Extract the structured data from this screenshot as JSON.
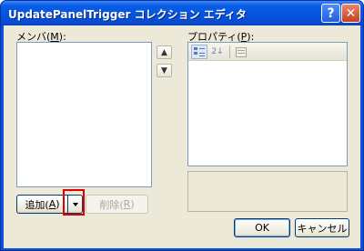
{
  "window": {
    "title": "UpdatePanelTrigger コレクション エディタ",
    "help_glyph": "?",
    "close_glyph": "✕"
  },
  "members": {
    "label_main": "メンバ(",
    "label_key": "M",
    "label_end": "):"
  },
  "properties": {
    "label_main": "プロパティ(",
    "label_key": "P",
    "label_end": "):",
    "sort_alpha_glyph": "2↓"
  },
  "order": {
    "up_glyph": "▲",
    "down_glyph": "▼"
  },
  "buttons": {
    "add_main": "追加(",
    "add_key": "A",
    "add_end": ")",
    "remove_main": "削除(",
    "remove_key": "R",
    "remove_end": ")",
    "ok": "OK",
    "cancel": "キャンセル"
  },
  "colors": {
    "titlebar": "#0553de",
    "dialog_face": "#ece9d8",
    "highlight": "#e00000"
  }
}
